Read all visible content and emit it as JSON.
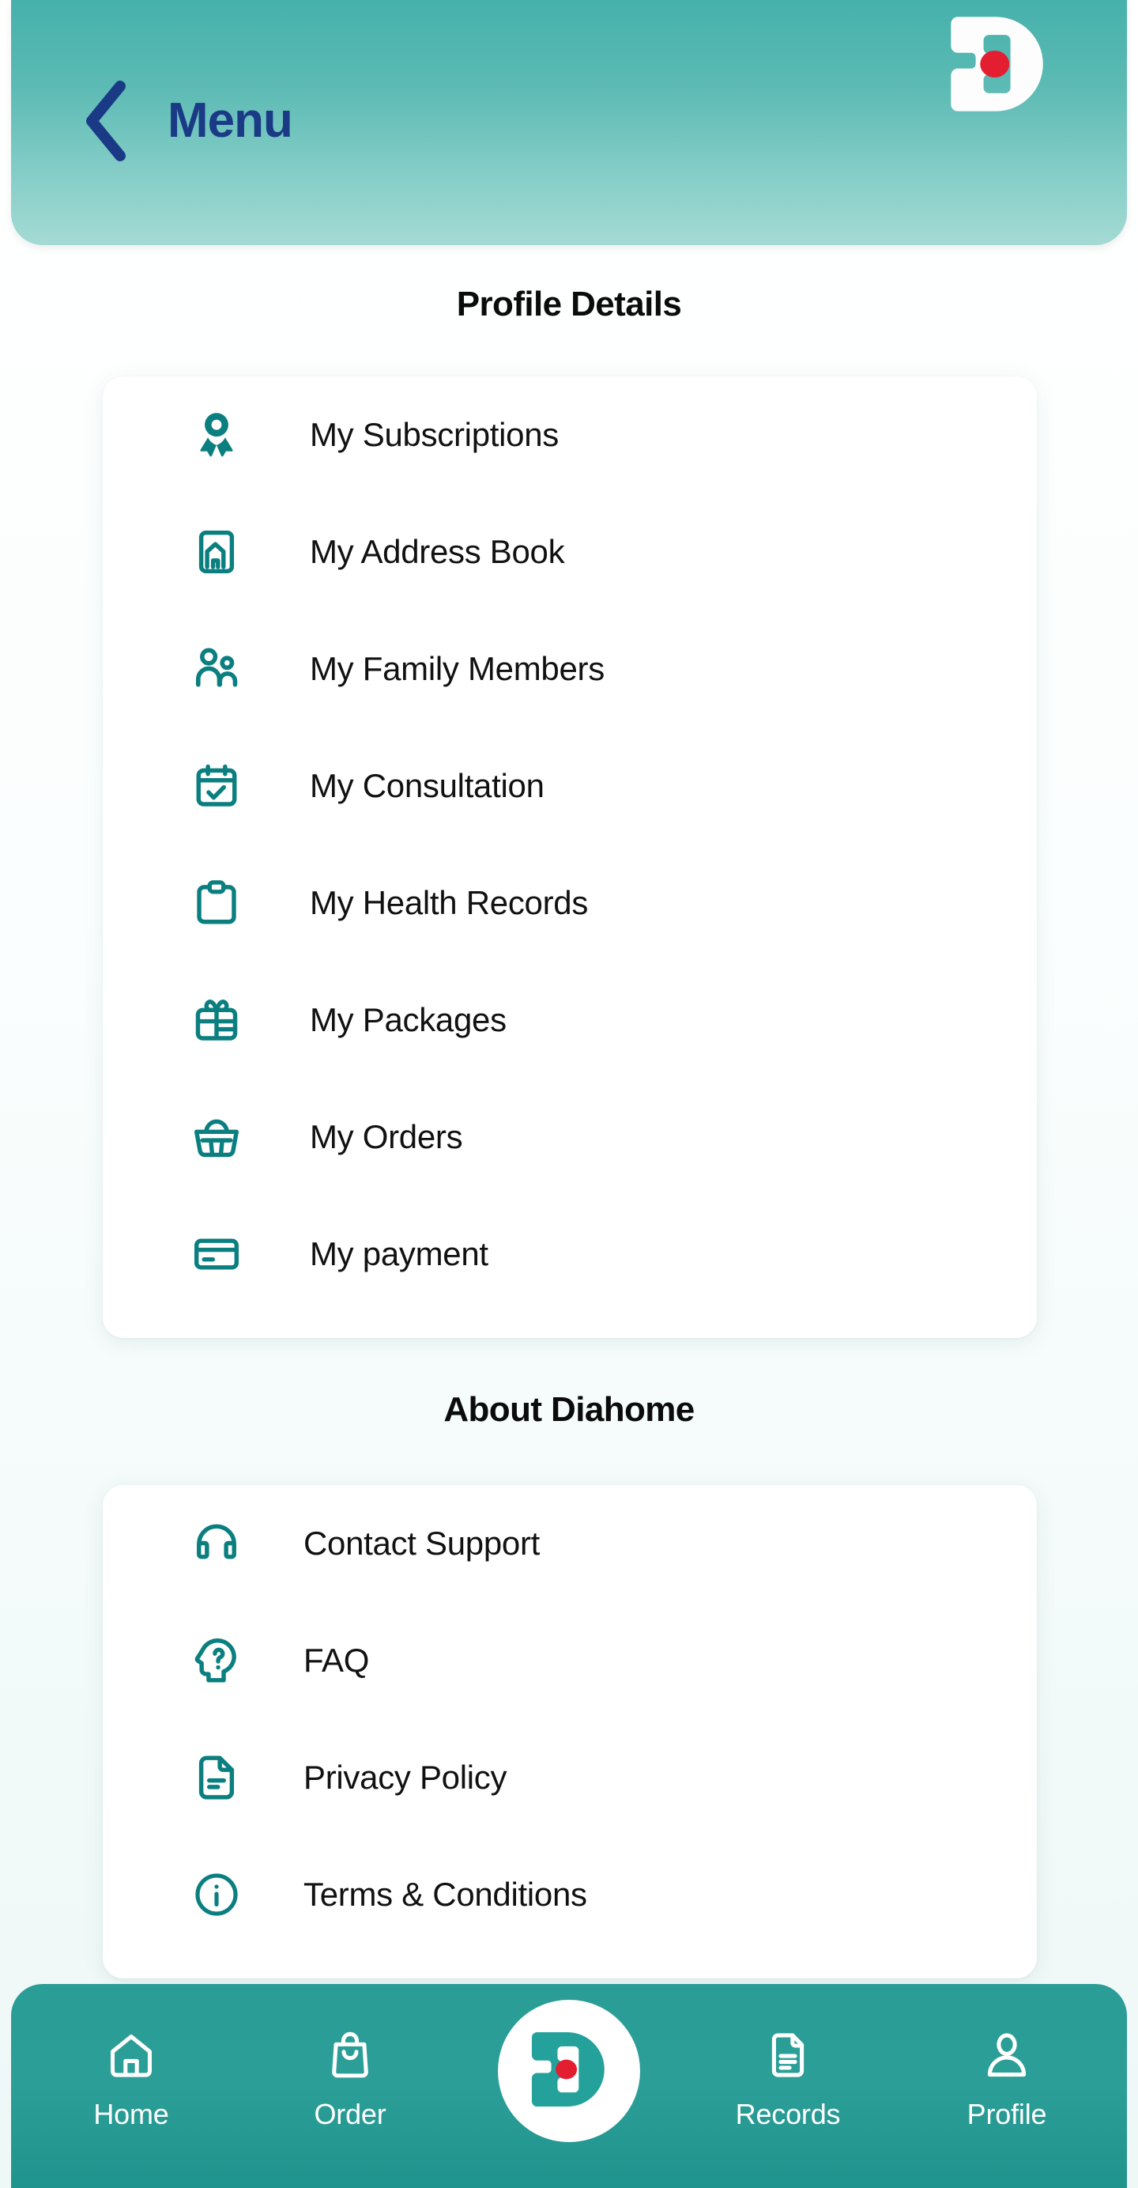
{
  "header": {
    "title": "Menu",
    "back_icon": "chevron-left-icon",
    "logo_icon": "diahome-d-logo",
    "title_color": "#1a3a86",
    "gradient_from": "#46b1ab",
    "gradient_to": "#a5dad4"
  },
  "sections": [
    {
      "id": "profile",
      "title": "Profile Details",
      "items": [
        {
          "label": "My Subscriptions",
          "icon": "award-ribbon-icon"
        },
        {
          "label": "My Address Book",
          "icon": "home-card-icon"
        },
        {
          "label": "My Family Members",
          "icon": "users-icon"
        },
        {
          "label": "My Consultation",
          "icon": "calendar-check-icon"
        },
        {
          "label": "My Health Records",
          "icon": "clipboard-icon"
        },
        {
          "label": "My Packages",
          "icon": "gift-icon"
        },
        {
          "label": "My Orders",
          "icon": "shopping-basket-icon"
        },
        {
          "label": "My payment",
          "icon": "credit-card-icon"
        }
      ]
    },
    {
      "id": "about",
      "title": "About Diahome",
      "items": [
        {
          "label": "Contact Support",
          "icon": "headphones-icon"
        },
        {
          "label": "FAQ",
          "icon": "head-question-icon"
        },
        {
          "label": "Privacy Policy",
          "icon": "document-text-icon"
        },
        {
          "label": "Terms & Conditions",
          "icon": "info-circle-icon"
        }
      ]
    }
  ],
  "bottom_nav": {
    "items": [
      {
        "label": "Home",
        "icon": "home-icon",
        "active": false
      },
      {
        "label": "Order",
        "icon": "shopping-bag-icon",
        "active": false
      },
      {
        "label": "Records",
        "icon": "document-icon",
        "active": false
      },
      {
        "label": "Profile",
        "icon": "person-icon",
        "active": true
      }
    ],
    "center_button": {
      "icon": "diahome-d-logo"
    },
    "background_color": "#2a9d96"
  },
  "theme": {
    "teal": "#0b7f80",
    "nav_teal": "#2a9d96",
    "accent_red": "#e31e31",
    "text": "#111111"
  }
}
